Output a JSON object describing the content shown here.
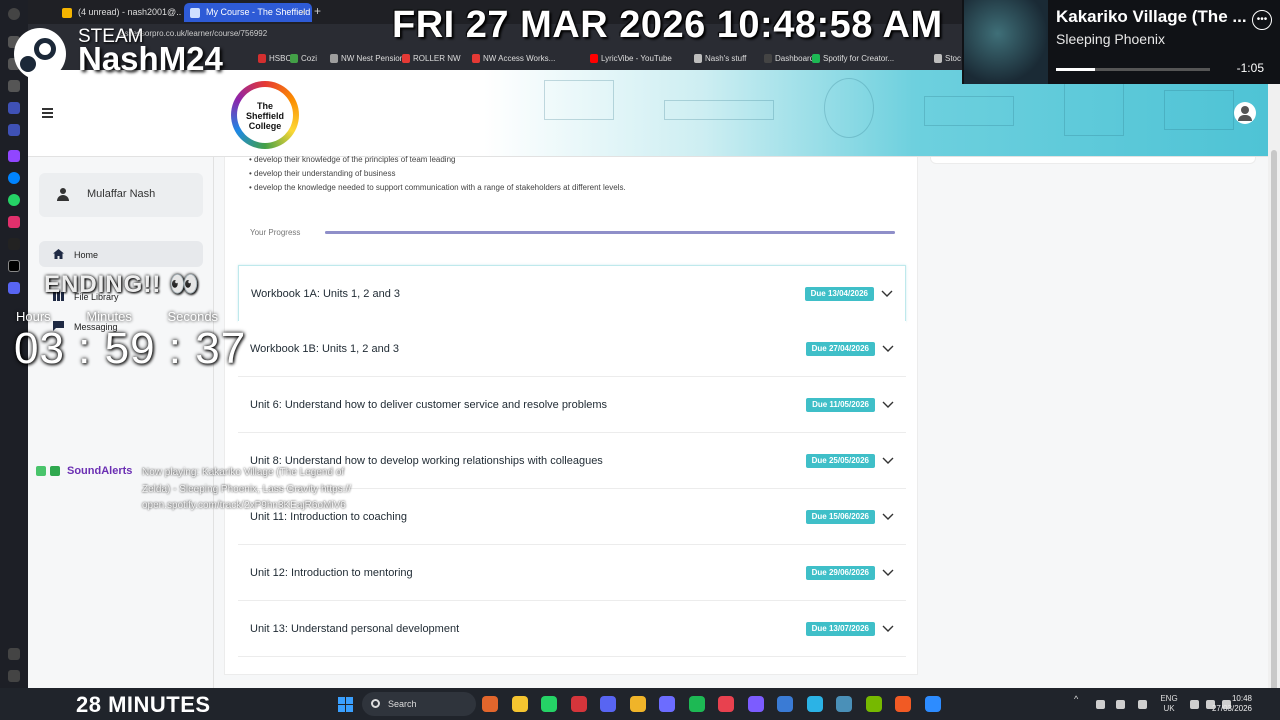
{
  "browser": {
    "tabs": [
      {
        "label": "(4 unread) - nash2001@..."
      },
      {
        "label": "My Course - The Sheffield"
      }
    ],
    "url": "assessorpro.co.uk/learner/course/756992",
    "bookmarks": [
      "HSBC",
      "Cozi",
      "NW Nest Pension",
      "ROLLER NW",
      "NW Access Works...",
      "LyricVibe - YouTube",
      "Nash's stuff",
      "Dashboard",
      "Spotify for Creator...",
      "Stoc"
    ],
    "bookmark_colors": [
      "#d32f2f",
      "#43a047",
      "#9e9e9e",
      "#e53935",
      "#e53935",
      "#ff0000",
      "#bdbdbd",
      "#444444",
      "#1db954",
      "#bdbdbd"
    ]
  },
  "site": {
    "logo_text": "The Sheffield College",
    "user_name": "Mulaffar Nash",
    "nav": [
      {
        "label": "Home"
      },
      {
        "label": "File Library"
      },
      {
        "label": "Messaging"
      }
    ]
  },
  "course": {
    "outcomes": [
      "• develop their knowledge of the principles of team leading",
      "• develop their understanding of business",
      "• develop the knowledge needed to support communication with a range of stakeholders at different levels."
    ],
    "progress_label": "Your Progress",
    "progress_fraction": 1.0,
    "units": [
      {
        "title": "Workbook 1A: Units 1, 2 and 3",
        "due": "Due 13/04/2026"
      },
      {
        "title": "Workbook 1B: Units 1, 2 and 3",
        "due": "Due 27/04/2026"
      },
      {
        "title": "Unit 6: Understand how to deliver customer service and resolve problems",
        "due": "Due 11/05/2026"
      },
      {
        "title": "Unit 8: Understand how to develop working relationships with colleagues",
        "due": "Due 25/05/2026"
      },
      {
        "title": "Unit 11: Introduction to coaching",
        "due": "Due 15/06/2026"
      },
      {
        "title": "Unit 12: Introduction to mentoring",
        "due": "Due 29/06/2026"
      },
      {
        "title": "Unit 13: Understand personal development",
        "due": "Due 13/07/2026"
      }
    ],
    "due_color": "#3fbfc8"
  },
  "overlay": {
    "clock": "FRI 27 MAR 2026 10:48:58 AM",
    "steam": "STEAM",
    "streamer": "NashM24",
    "now_playing": {
      "title": "Kakariko Village (The ...",
      "artist": "Sleeping Phoenix",
      "remaining": "-1:05",
      "progress_fraction": 0.25,
      "more_icon": "ellipsis-icon"
    },
    "ending_text": "ENDING!! 👀",
    "timer_labels": [
      "Hours",
      "Minutes",
      "Seconds"
    ],
    "countdown": "03 : 59 : 37",
    "soundalerts": "SoundAlerts",
    "soundalerts_np": "Now playing: Kakariko Village (The Legend of Zelda) - Sleeping Phoenix, Lass Gravity https://open.spotify.com/track/2xP9hn3KEajR6oMiV6",
    "minutes_banner": "28 MINUTES"
  },
  "taskbar": {
    "search_label": "Search",
    "apps": [
      "widgets-icon",
      "file-explorer-icon",
      "whatsapp-icon",
      "opera-icon",
      "discord-icon",
      "trophy-icon",
      "calculator-icon",
      "spotify-icon",
      "app-icon",
      "ai-icon",
      "store-icon",
      "edge-icon",
      "terminal-icon",
      "nvidia-icon",
      "brave-icon",
      "zoom-icon"
    ],
    "app_colors": [
      "#e2662c",
      "#f4c430",
      "#25d366",
      "#d4353b",
      "#5865f2",
      "#f0b429",
      "#6c6cff",
      "#1db954",
      "#e8414f",
      "#7c5cff",
      "#3a7bd5",
      "#2bb3e6",
      "#4a90b8",
      "#76b900",
      "#f15a24",
      "#2d8cff"
    ],
    "lang_top": "ENG",
    "lang_bottom": "UK",
    "time": "10:48",
    "date": "27/03/2026"
  }
}
